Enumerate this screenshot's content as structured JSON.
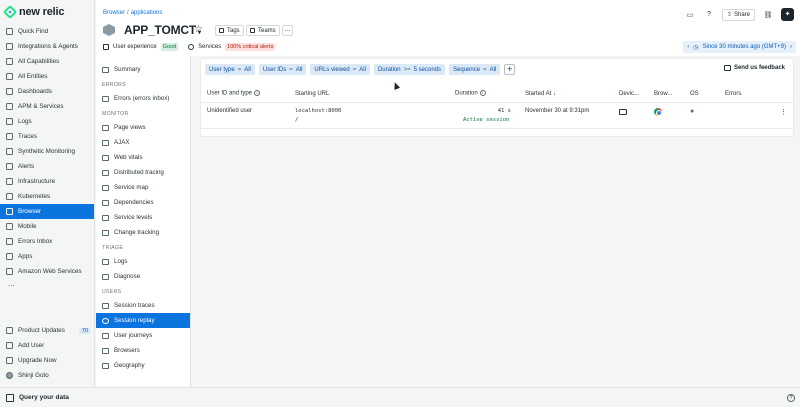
{
  "brand": {
    "name": "new relic"
  },
  "leftnav": {
    "items": [
      {
        "label": "Quick Find",
        "icon": "search-icon"
      },
      {
        "label": "Integrations & Agents",
        "icon": "plus-icon"
      },
      {
        "label": "All Capabilities",
        "icon": "grid-icon"
      },
      {
        "label": "All Entities",
        "icon": "entities-icon"
      },
      {
        "label": "Dashboards",
        "icon": "dashboard-icon"
      },
      {
        "label": "APM & Services",
        "icon": "apm-icon"
      },
      {
        "label": "Logs",
        "icon": "logs-icon"
      },
      {
        "label": "Traces",
        "icon": "traces-icon"
      },
      {
        "label": "Synthetic Monitoring",
        "icon": "synthetics-icon"
      },
      {
        "label": "Alerts",
        "icon": "bell-icon"
      },
      {
        "label": "Infrastructure",
        "icon": "infrastructure-icon"
      },
      {
        "label": "Kubernetes",
        "icon": "kubernetes-icon"
      },
      {
        "label": "Browser",
        "icon": "browser-icon"
      },
      {
        "label": "Mobile",
        "icon": "mobile-icon"
      },
      {
        "label": "Errors Inbox",
        "icon": "inbox-icon"
      },
      {
        "label": "Apps",
        "icon": "apps-icon"
      },
      {
        "label": "Amazon Web Services",
        "icon": "cloud-icon"
      }
    ],
    "more": "...",
    "bottom": [
      {
        "label": "Product Updates",
        "badge": "70",
        "icon": "updates-icon"
      },
      {
        "label": "Add User",
        "icon": "add-user-icon"
      },
      {
        "label": "Upgrade Now",
        "icon": "upgrade-icon"
      },
      {
        "label": "Shinji Goto",
        "icon": "avatar-icon"
      }
    ],
    "query": "Query your data"
  },
  "header": {
    "breadcrumb": [
      "Browser",
      "applications"
    ],
    "app_title": "APP_TOMCT",
    "tags_label": "Tags",
    "teams_label": "Teams",
    "user_experience": "User experience",
    "ux_status": "Good",
    "services": "Services",
    "alerts": "100% critical alerts",
    "share": "Share",
    "time_range": "Since 30 minutes ago (GMT+9)"
  },
  "subnav": {
    "summary": "Summary",
    "sections": [
      {
        "heading": "ERRORS",
        "items": [
          "Errors (errors inbox)"
        ]
      },
      {
        "heading": "MONITOR",
        "items": [
          "Page views",
          "AJAX",
          "Web vitals",
          "Distributed tracing",
          "Service map",
          "Dependencies",
          "Service levels",
          "Change tracking"
        ]
      },
      {
        "heading": "TRIAGE",
        "items": [
          "Logs",
          "Diagnose"
        ]
      },
      {
        "heading": "USERS",
        "items": [
          "Session traces",
          "Session replay",
          "User journeys",
          "Browsers",
          "Geography"
        ]
      }
    ],
    "active": "Session replay"
  },
  "filters": [
    {
      "key": "User type",
      "op": "=",
      "value": "All"
    },
    {
      "key": "User IDs",
      "op": "=",
      "value": "All"
    },
    {
      "key": "URLs viewed",
      "op": "=",
      "value": "All"
    },
    {
      "key": "Duration",
      "op": ">=",
      "value": "5 seconds"
    },
    {
      "key": "Sequence",
      "op": "=",
      "value": "All"
    }
  ],
  "feedback": "Send us feedback",
  "table": {
    "headers": [
      "User ID and type",
      "Starting URL",
      "Duration",
      "Started At",
      "Devic...",
      "Brow...",
      "OS",
      "Errors"
    ],
    "rows": [
      {
        "user": "Unidentified user",
        "url": "localhost:8000",
        "path": "/",
        "duration": "41 s",
        "status": "Active session",
        "started": "November 30 at 9:31pm",
        "errors": ""
      }
    ]
  }
}
